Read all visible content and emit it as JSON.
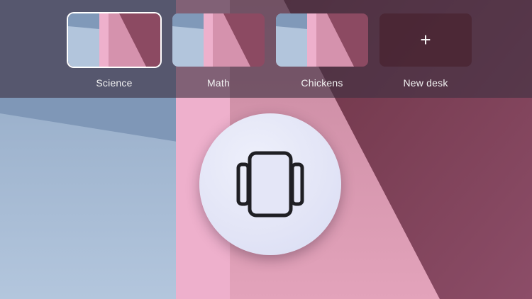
{
  "colors": {
    "desk_bar_bg": "#3e3040",
    "active_outline": "#ffffff",
    "label_text": "#f2f2f2",
    "overview_button_bg": "#e2e4f6",
    "icon_stroke": "#1f1f24",
    "wallpaper_blue": "#a8bcd4",
    "wallpaper_pink": "#e9a6c3",
    "wallpaper_rose": "#c07a92",
    "wallpaper_maroon": "#7d4258"
  },
  "desks": [
    {
      "label": "Science",
      "active": true
    },
    {
      "label": "Math",
      "active": false
    },
    {
      "label": "Chickens",
      "active": false
    }
  ],
  "new_desk": {
    "label": "New desk",
    "icon": "plus-icon",
    "glyph": "+"
  },
  "overview_button": {
    "icon": "window-cycle-icon"
  }
}
